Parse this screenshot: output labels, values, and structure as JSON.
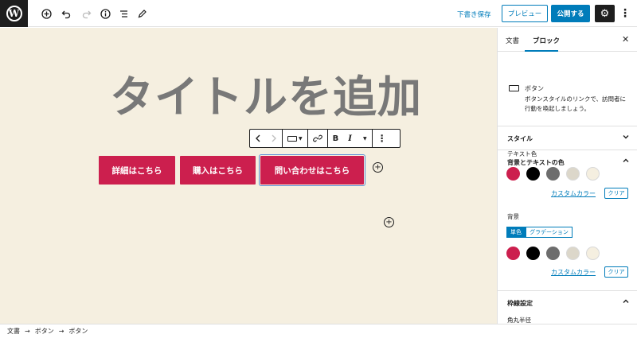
{
  "toolbar": {
    "draft_save": "下書き保存",
    "preview": "プレビュー",
    "publish": "公開する"
  },
  "post": {
    "title_placeholder": "タイトルを追加"
  },
  "block_toolbar": {
    "bold": "B",
    "italic": "I"
  },
  "buttons": [
    {
      "label": "詳細はこちら",
      "color": "#cc1f4e"
    },
    {
      "label": "購入はこちら",
      "color": "#cc1f4e"
    },
    {
      "label": "問い合わせはこちら",
      "color": "#cc1f4e"
    }
  ],
  "sidebar": {
    "tabs": [
      "文書",
      "ブロック"
    ],
    "active_tab": "ブロック",
    "block": {
      "name": "ボタン",
      "description": "ボタンスタイルのリンクで、訪問者に行動を喚起しましょう。"
    },
    "panels": {
      "style": "スタイル",
      "color": "背景とテキストの色",
      "border": "枠線設定"
    },
    "text_color_label": "テキスト色",
    "background_label": "背景",
    "custom_color": "カスタムカラー",
    "clear": "クリア",
    "solid": "単色",
    "gradient": "グラデーション",
    "border_radius_label": "角丸半径",
    "palette": [
      "#cc1f4e",
      "#000000",
      "#6d6d6d",
      "#dcd7ca",
      "#f5efe0"
    ]
  },
  "breadcrumb": [
    "文書",
    "ボタン",
    "ボタン"
  ]
}
